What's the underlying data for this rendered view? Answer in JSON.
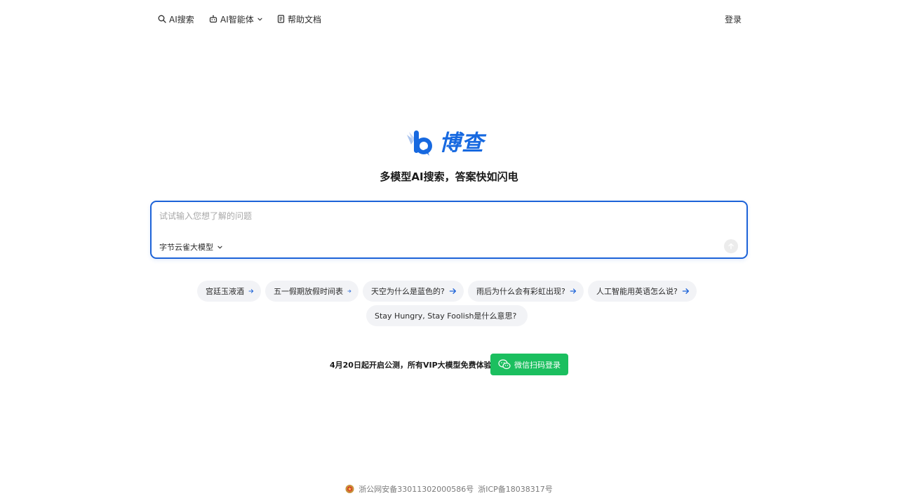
{
  "nav": {
    "search_label": "AI搜索",
    "agent_label": "AI智能体",
    "docs_label": "帮助文档",
    "login_label": "登录"
  },
  "brand": {
    "name": "博查",
    "tagline": "多模型AI搜索，答案快如闪电",
    "color": "#1769e0"
  },
  "search": {
    "placeholder": "试试输入您想了解的问题",
    "value": "",
    "model_selected": "字节云雀大模型",
    "accent_color": "#1d63d8"
  },
  "suggestions": [
    {
      "label": "宫廷玉液酒"
    },
    {
      "label": "五一假期放假时间表"
    },
    {
      "label": "天空为什么是蓝色的?"
    },
    {
      "label": "雨后为什么会有彩虹出现?"
    },
    {
      "label": "人工智能用英语怎么说?"
    },
    {
      "label": "Stay Hungry, Stay Foolish是什么意思?"
    }
  ],
  "promo": {
    "text": "4月20日起开启公测，所有VIP大模型免费体验",
    "button_label": "微信扫码登录",
    "button_color": "#1bbf5f"
  },
  "footer": {
    "police_record": "浙公网安备33011302000586号",
    "icp_record": "浙ICP备18038317号"
  },
  "icons": {
    "nav_search": "search-icon",
    "nav_agent": "robot-icon",
    "nav_docs": "document-icon",
    "chevron": "chevron-down-icon",
    "send": "arrow-up-icon",
    "chip_arrow": "arrow-right-icon",
    "wechat": "wechat-icon",
    "police": "police-badge-icon"
  }
}
